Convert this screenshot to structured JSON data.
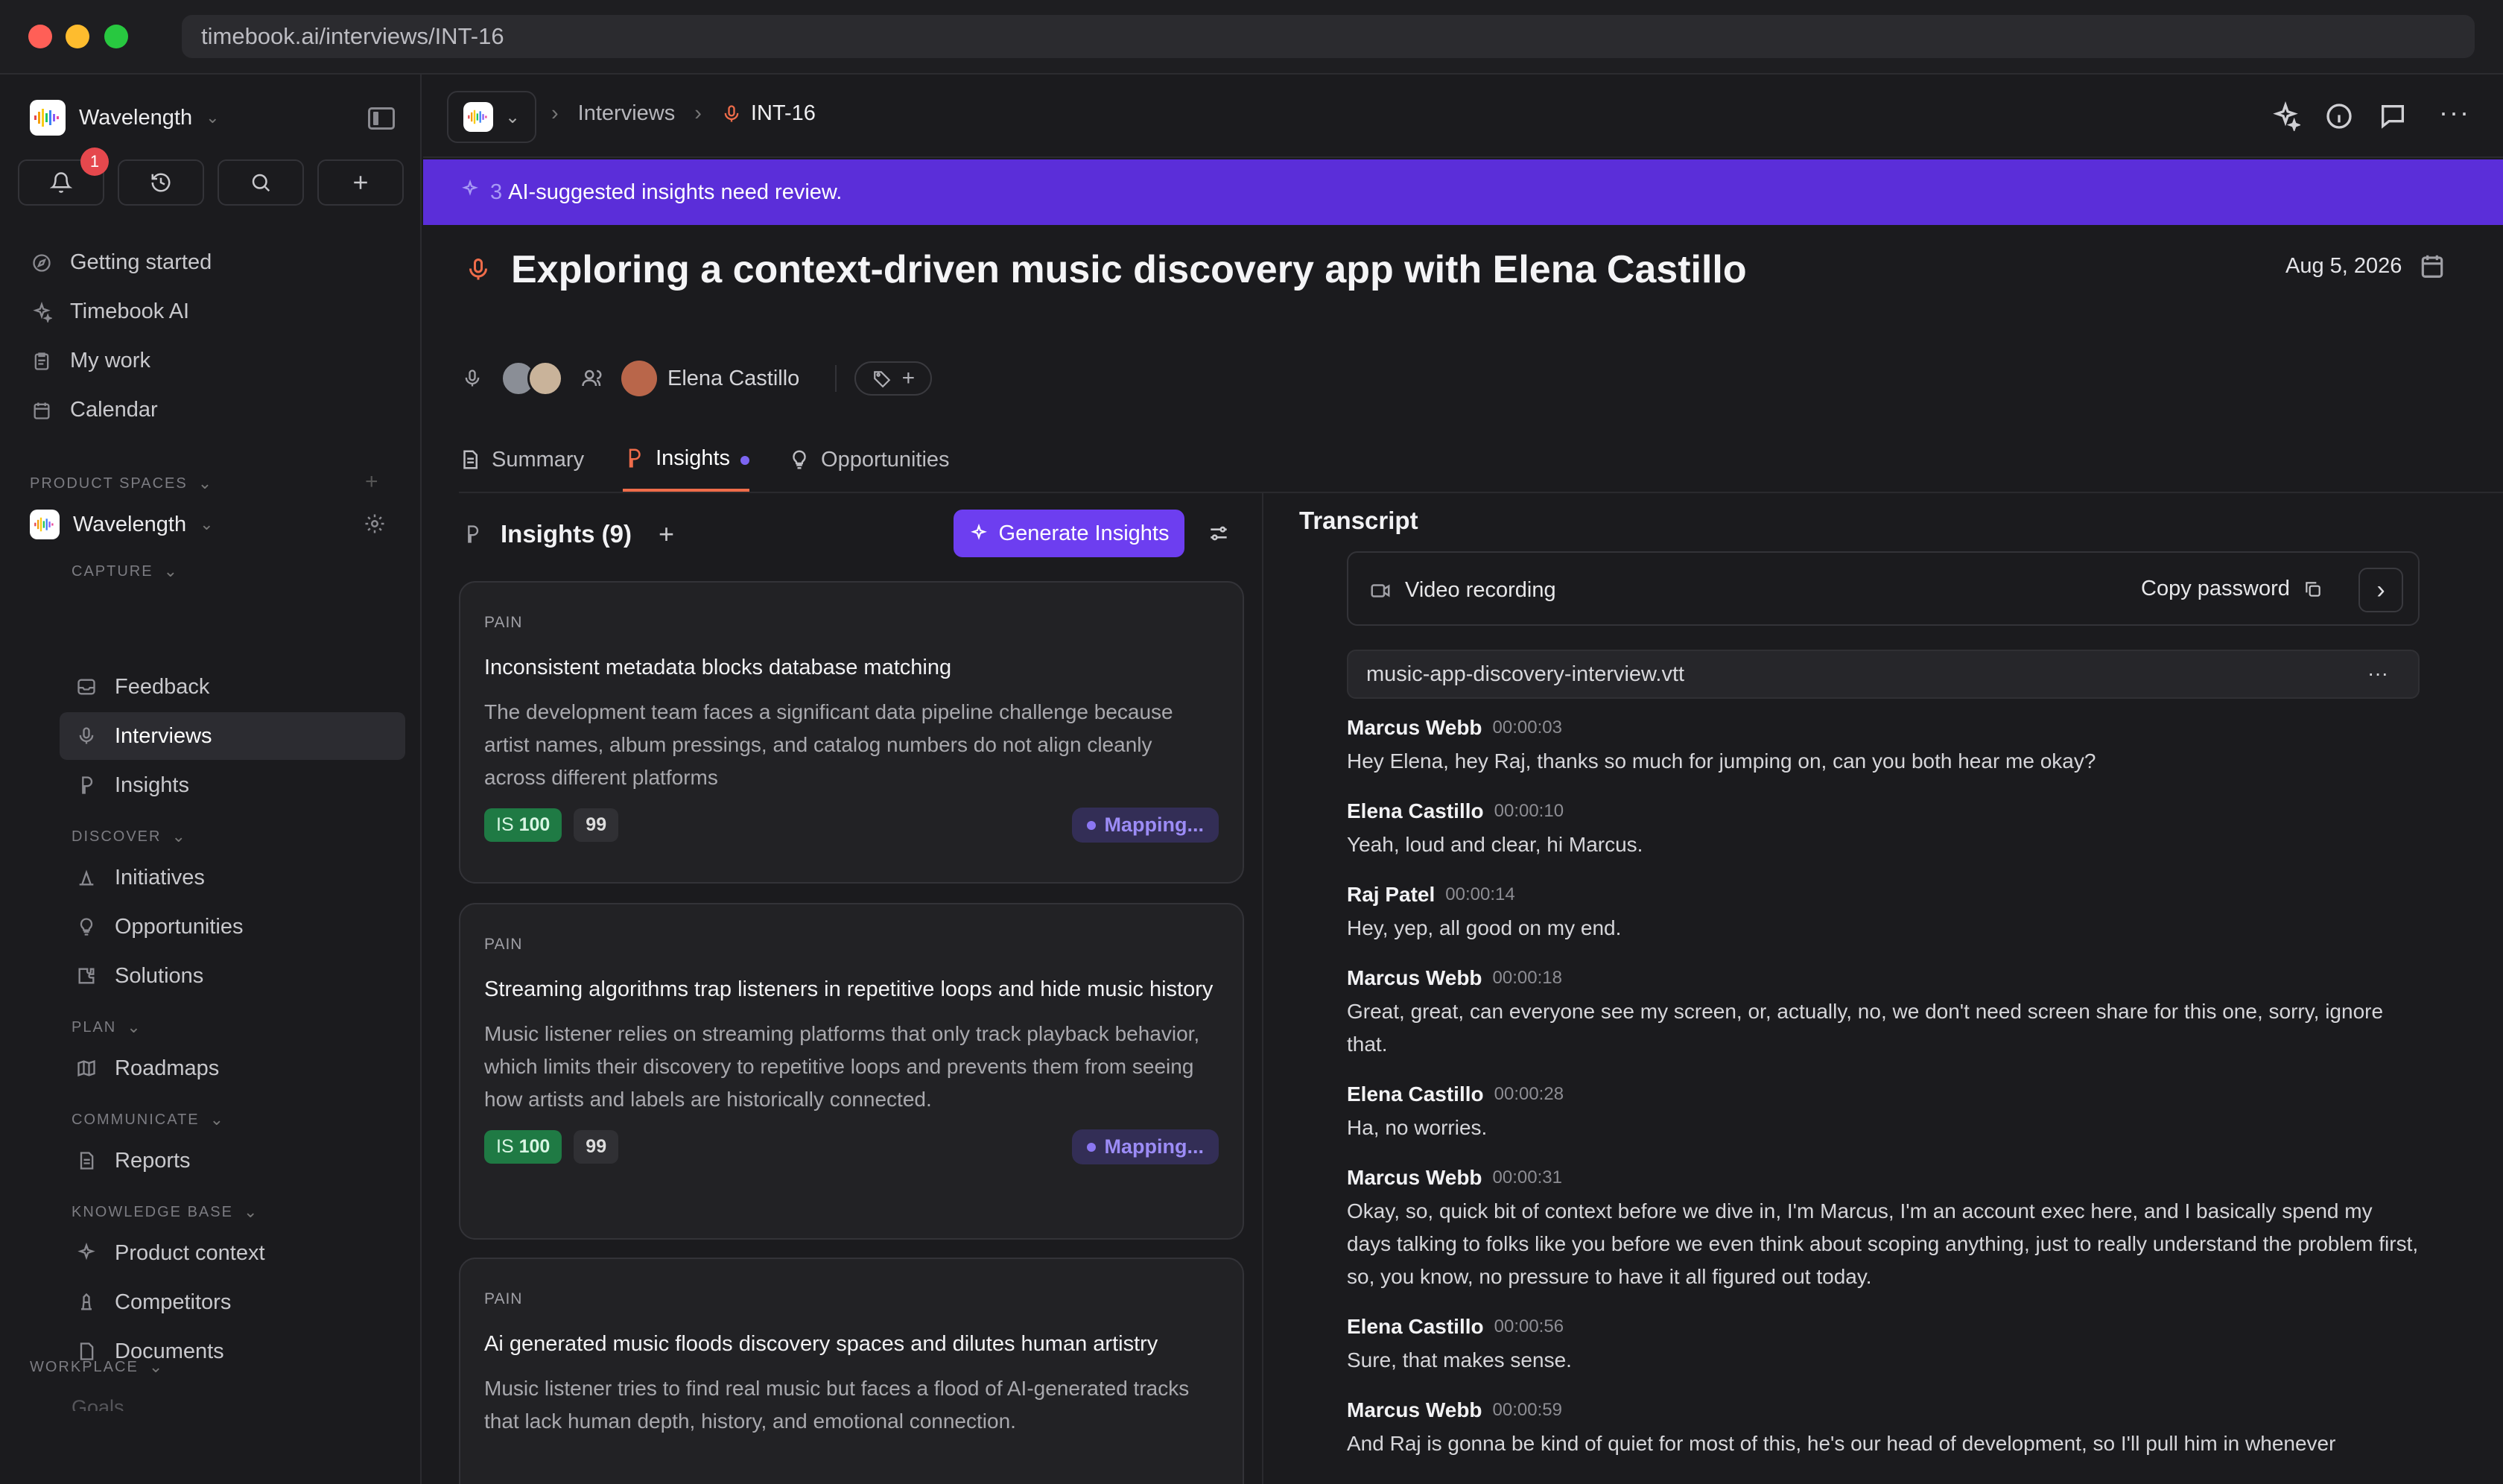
{
  "browser": {
    "url": "timebook.ai/interviews/INT-16",
    "colors": {
      "close": "#ff5f57",
      "min": "#febc2e",
      "max": "#28c840"
    }
  },
  "sidebar": {
    "workspace": "Wavelength",
    "notification_count": "1",
    "nav": [
      {
        "label": "Getting started",
        "icon": "compass-icon"
      },
      {
        "label": "Timebook AI",
        "icon": "sparkle-icon"
      },
      {
        "label": "My work",
        "icon": "clipboard-icon"
      },
      {
        "label": "Calendar",
        "icon": "calendar-icon"
      }
    ],
    "product_spaces_label": "PRODUCT SPACES",
    "space_name": "Wavelength",
    "capture_label": "CAPTURE",
    "capture": [
      "Feedback",
      "Interviews",
      "Insights"
    ],
    "discover_label": "DISCOVER",
    "discover": [
      "Initiatives",
      "Opportunities",
      "Solutions"
    ],
    "plan_label": "PLAN",
    "plan": [
      "Roadmaps"
    ],
    "communicate_label": "COMMUNICATE",
    "communicate": [
      "Reports"
    ],
    "kb_label": "KNOWLEDGE BASE",
    "kb": [
      "Product context",
      "Competitors",
      "Documents"
    ],
    "workplace_label": "WORKPLACE",
    "workplace_cut": "Goals"
  },
  "topbar": {
    "crumb_interviews": "Interviews",
    "crumb_id": "INT-16"
  },
  "banner": {
    "count": "3",
    "text": "AI-suggested insights need review.",
    "color": "#5b2ed9"
  },
  "interview": {
    "title": "Exploring a context-driven music discovery app with Elena Castillo",
    "date": "Aug 5, 2026",
    "participant": "Elena Castillo"
  },
  "tabs": [
    {
      "label": "Summary"
    },
    {
      "label": "Insights"
    },
    {
      "label": "Opportunities"
    }
  ],
  "insights": {
    "heading": "Insights (9)",
    "generate_label": "Generate Insights",
    "cards": [
      {
        "label": "PAIN",
        "title": "Inconsistent metadata blocks database matching",
        "desc": "The development team faces a significant data pipeline challenge because artist names, album pressings, and catalog numbers do not align cleanly across different platforms",
        "is_prefix": "IS",
        "score": "100",
        "quote": "99",
        "status": "Mapping..."
      },
      {
        "label": "PAIN",
        "title": "Streaming algorithms trap listeners in repetitive loops and hide music history",
        "desc": "Music listener relies on streaming platforms that only track playback behavior, which limits their discovery to repetitive loops and prevents them from seeing how artists and labels are historically connected.",
        "is_prefix": "IS",
        "score": "100",
        "quote": "99",
        "status": "Mapping..."
      },
      {
        "label": "PAIN",
        "title": "Ai generated music floods discovery spaces and dilutes human artistry",
        "desc": "Music listener tries to find real music but faces a flood of AI-generated tracks that lack human depth, history, and emotional connection."
      }
    ]
  },
  "transcript": {
    "heading": "Transcript",
    "video_label": "Video recording",
    "copy_password": "Copy password",
    "file": "music-app-discovery-interview.vtt",
    "entries": [
      {
        "speaker": "Marcus Webb",
        "time": "00:00:03",
        "text": "Hey Elena, hey Raj, thanks so much for jumping on, can you both hear me okay?"
      },
      {
        "speaker": "Elena Castillo",
        "time": "00:00:10",
        "text": "Yeah, loud and clear, hi Marcus."
      },
      {
        "speaker": "Raj Patel",
        "time": "00:00:14",
        "text": "Hey, yep, all good on my end."
      },
      {
        "speaker": "Marcus Webb",
        "time": "00:00:18",
        "text": "Great, great, can everyone see my screen, or, actually, no, we don't need screen share for this one, sorry, ignore that."
      },
      {
        "speaker": "Elena Castillo",
        "time": "00:00:28",
        "text": "Ha, no worries."
      },
      {
        "speaker": "Marcus Webb",
        "time": "00:00:31",
        "text": "Okay, so, quick bit of context before we dive in, I'm Marcus, I'm an account exec here, and I basically spend my days talking to folks like you before we even think about scoping anything, just to really understand the problem first, so, you know, no pressure to have it all figured out today."
      },
      {
        "speaker": "Elena Castillo",
        "time": "00:00:56",
        "text": "Sure, that makes sense."
      },
      {
        "speaker": "Marcus Webb",
        "time": "00:00:59",
        "text": "And Raj is gonna be kind of quiet for most of this, he's our head of development, so I'll pull him in whenever"
      }
    ]
  }
}
